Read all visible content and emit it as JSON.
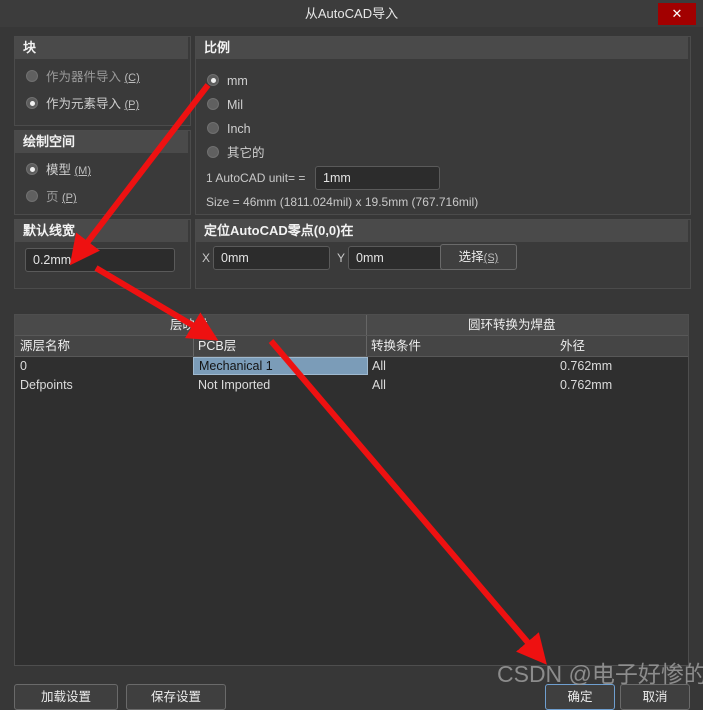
{
  "window": {
    "title": "从AutoCAD导入",
    "close_label": "✕"
  },
  "block_panel": {
    "header": "块",
    "options": [
      {
        "label": "作为器件导入",
        "key": "(C)",
        "checked": false
      },
      {
        "label": "作为元素导入",
        "key": "(P)",
        "checked": true
      }
    ]
  },
  "draw_space_panel": {
    "header": "绘制空间",
    "options": [
      {
        "label": "模型",
        "key": "(M)",
        "checked": true
      },
      {
        "label": "页",
        "key": "(P)",
        "checked": false
      }
    ]
  },
  "line_width_panel": {
    "header": "默认线宽",
    "value": "0.2mm"
  },
  "scale_panel": {
    "header": "比例",
    "options": [
      {
        "label": "mm",
        "checked": true
      },
      {
        "label": "Mil",
        "checked": false
      },
      {
        "label": "Inch",
        "checked": false
      },
      {
        "label": "其它的",
        "checked": false
      }
    ],
    "unit_label": "1 AutoCAD unit= =",
    "unit_value": "1mm",
    "size_text": "Size = 46mm (1811.024mil) x 19.5mm (767.716mil)"
  },
  "origin_panel": {
    "header": "定位AutoCAD零点(0,0)在",
    "x_label": "X",
    "x_value": "0mm",
    "y_label": "Y",
    "y_value": "0mm",
    "select_button": "选择",
    "select_button_key": "(S)"
  },
  "table": {
    "group_headers": [
      "层映射",
      "圆环转换为焊盘"
    ],
    "columns": [
      "源层名称",
      "PCB层",
      "转换条件",
      "外径"
    ],
    "rows": [
      {
        "source_layer": "0",
        "pcb_layer": "Mechanical 1",
        "condition": "All",
        "outer_diameter": "0.762mm",
        "selected": true
      },
      {
        "source_layer": "Defpoints",
        "pcb_layer": "Not Imported",
        "condition": "All",
        "outer_diameter": "0.762mm",
        "selected": false
      }
    ]
  },
  "footer": {
    "load_settings": "加载设置",
    "save_settings": "保存设置",
    "ok": "确定",
    "cancel": "取消"
  },
  "watermark": {
    "text": "CSDN @电子好惨的兜头强"
  },
  "colors": {
    "accent_selection": "#7b9cb8",
    "close_red": "#a20000",
    "annotation_red": "#ee1111",
    "window_bg": "#373737",
    "panel_bg": "#3a3a3a"
  }
}
